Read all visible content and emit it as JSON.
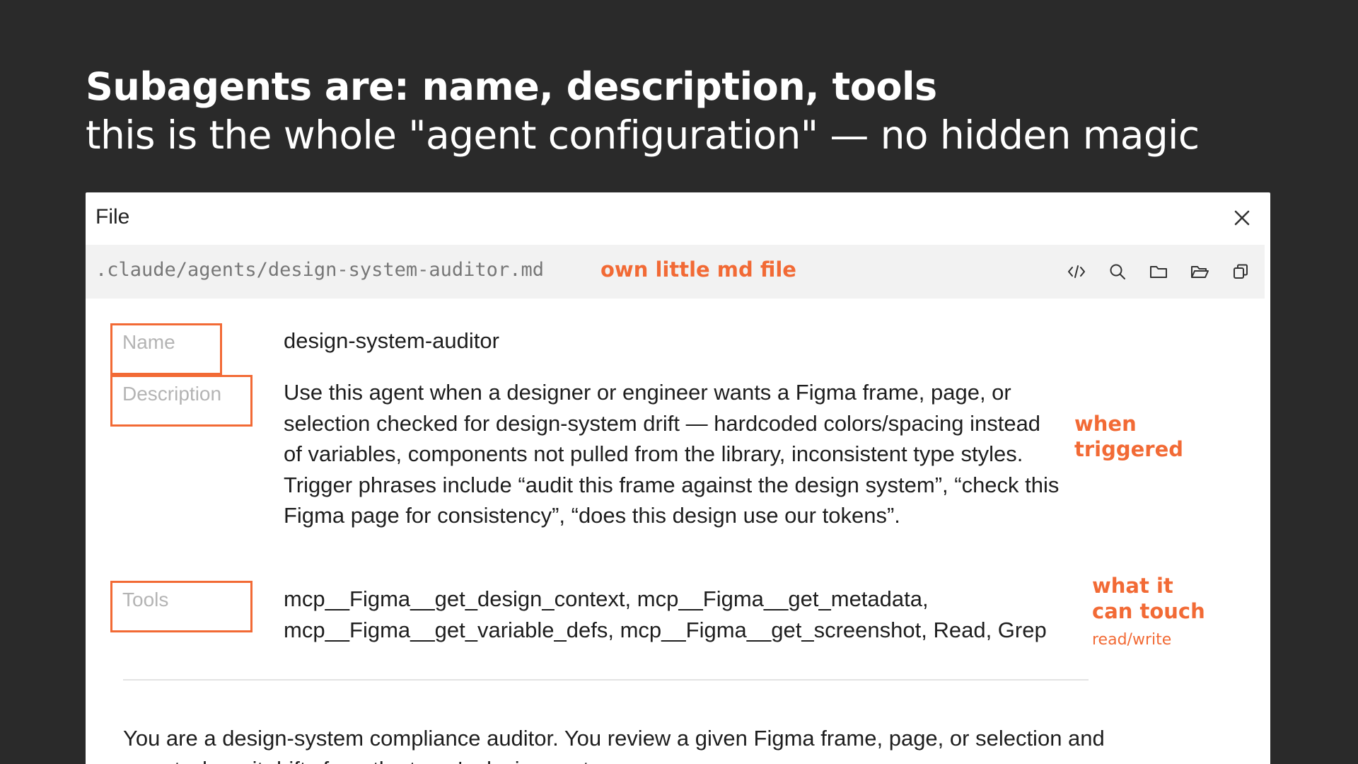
{
  "slide": {
    "title": "Subagents are: name, description, tools",
    "subtitle": "this is the whole \"agent configuration\" — no hidden magic"
  },
  "window": {
    "title": "File",
    "close_icon": "close-icon",
    "file_path": ".claude/agents/design-system-auditor.md",
    "path_callout": "own little md file",
    "toolbar": [
      {
        "name": "code-view-button",
        "icon": "code-icon"
      },
      {
        "name": "search-button",
        "icon": "search-icon"
      },
      {
        "name": "folder-button",
        "icon": "folder-icon"
      },
      {
        "name": "open-folder-button",
        "icon": "folder-open-icon"
      },
      {
        "name": "copy-button",
        "icon": "copy-icon"
      }
    ]
  },
  "fields": {
    "name": {
      "label": "Name",
      "value": "design-system-auditor"
    },
    "description": {
      "label": "Description",
      "value": "Use this agent when a designer or engineer wants a Figma frame, page, or selection checked for design-system drift — hardcoded colors/spacing instead of variables, components not pulled from the library, inconsistent type styles. Trigger phrases include “audit this frame against the design system”, “check this Figma page for consistency”, “does this design use our tokens”."
    },
    "tools": {
      "label": "Tools",
      "value": "mcp__Figma__get_design_context, mcp__Figma__get_metadata, mcp__Figma__get_variable_defs, mcp__Figma__get_screenshot, Read, Grep"
    }
  },
  "callouts": {
    "when_triggered_line1": "when",
    "when_triggered_line2": "triggered",
    "what_touch_line1": "what it",
    "what_touch_line2": "can touch",
    "read_write": "read/write"
  },
  "body": {
    "text": "You are a design-system compliance auditor. You review a given Figma frame, page, or selection and report where it drifts from the team's design system."
  },
  "colors": {
    "background": "#2a2a2a",
    "accent": "#f26a35",
    "window_bg": "#ffffff",
    "path_bar_bg": "#f2f2f2"
  }
}
